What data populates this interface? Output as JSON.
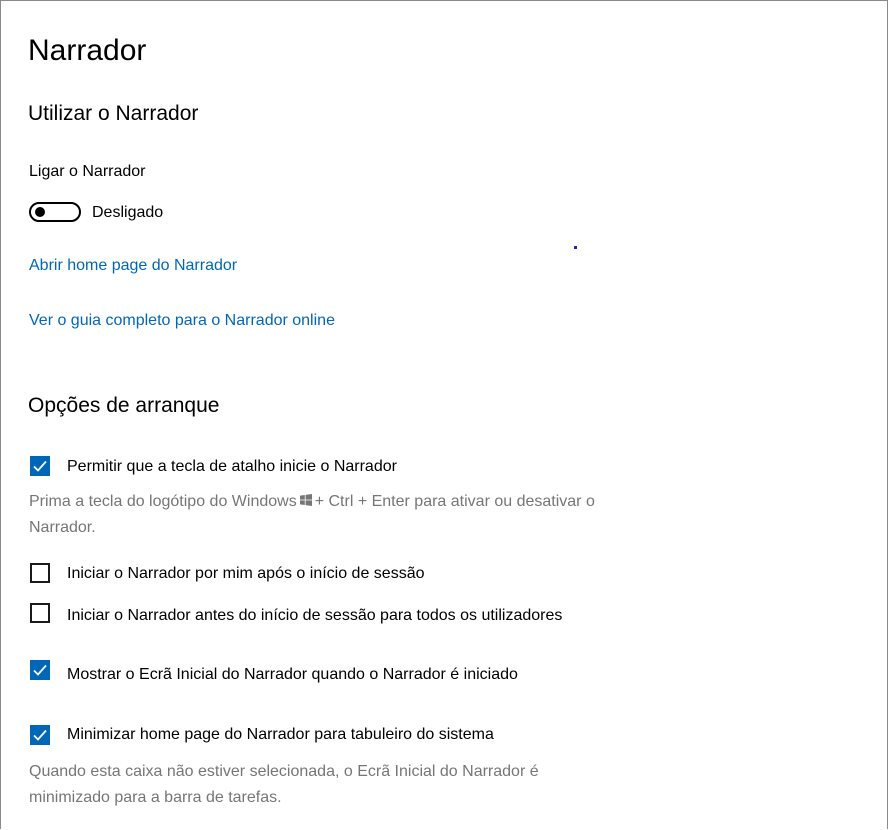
{
  "page": {
    "title": "Narrador"
  },
  "use_section": {
    "heading": "Utilizar o Narrador",
    "toggle_label": "Ligar o Narrador",
    "toggle_state": "Desligado",
    "toggle_on": false,
    "links": [
      "Abrir home page do Narrador",
      "Ver o guia completo para o Narrador online"
    ]
  },
  "startup_section": {
    "heading": "Opções de arranque",
    "options": [
      {
        "label": "Permitir que a tecla de atalho inicie o Narrador",
        "checked": true
      },
      {
        "label": "Iniciar o Narrador por mim após o início de sessão",
        "checked": false
      },
      {
        "label": "Iniciar o Narrador antes do início de sessão para todos os utilizadores",
        "checked": false
      },
      {
        "label": "Mostrar o Ecrã Inicial do Narrador quando o Narrador é iniciado",
        "checked": true
      },
      {
        "label": "Minimizar home page do Narrador para tabuleiro do sistema",
        "checked": true
      }
    ],
    "shortcut_hint_before": "Prima a tecla do logótipo do Windows",
    "shortcut_hint_after": "+ Ctrl + Enter para ativar ou desativar o Narrador.",
    "minimize_hint": "Quando esta caixa não estiver selecionada, o Ecrã Inicial do Narrador é minimizado para a barra de tarefas."
  },
  "colors": {
    "accent": "#0067b8",
    "hint": "#767676"
  },
  "icons": {
    "checkmark": "checkmark-icon",
    "windows_logo": "windows-logo-icon"
  }
}
